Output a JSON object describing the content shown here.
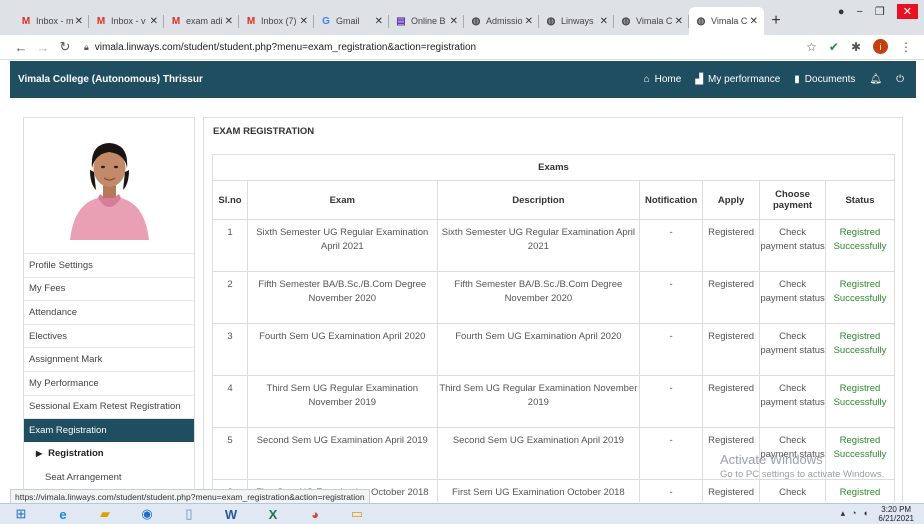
{
  "browser": {
    "tabs": [
      {
        "label": "Inbox - m",
        "icon": "gmail-icon",
        "glyph": "M",
        "color": "#d93025"
      },
      {
        "label": "Inbox - v",
        "icon": "gmail-icon",
        "glyph": "M",
        "color": "#d93025"
      },
      {
        "label": "exam adi",
        "icon": "gmail-icon",
        "glyph": "M",
        "color": "#d93025"
      },
      {
        "label": "Inbox (7)",
        "icon": "gmail-icon",
        "glyph": "M",
        "color": "#d93025"
      },
      {
        "label": "Gmail",
        "icon": "google-icon",
        "glyph": "G",
        "color": "#4285f4"
      },
      {
        "label": "Online B",
        "icon": "form-icon",
        "glyph": "▤",
        "color": "#673ab7"
      },
      {
        "label": "Admissio",
        "icon": "globe-icon",
        "glyph": "◍",
        "color": "#444"
      },
      {
        "label": "Linways",
        "icon": "globe-icon",
        "glyph": "◍",
        "color": "#444"
      },
      {
        "label": "Vimala C",
        "icon": "globe-icon",
        "glyph": "◍",
        "color": "#444"
      },
      {
        "label": "Vimala C",
        "icon": "globe-icon",
        "glyph": "◍",
        "color": "#444",
        "active": true
      }
    ],
    "url": "vimala.linways.com/student/student.php?menu=exam_registration&action=registration",
    "status_url": "https://vimala.linways.com/student/student.php?menu=exam_registration&action=registration"
  },
  "header": {
    "brand": "Vimala College (Autonomous) Thrissur",
    "nav": {
      "home": "Home",
      "performance": "My performance",
      "documents": "Documents"
    }
  },
  "sidebar": {
    "items": [
      "Profile Settings",
      "My Fees",
      "Attendance",
      "Electives",
      "Assignment Mark",
      "My Performance",
      "Sessional Exam Retest Registration",
      "Exam Registration"
    ],
    "sub_active": "Registration",
    "sub_other": "Seat Arrangement"
  },
  "main": {
    "title": "EXAM REGISTRATION",
    "group_header": "Exams",
    "columns": {
      "slno": "Sl.no",
      "exam": "Exam",
      "description": "Description",
      "notification": "Notification",
      "apply": "Apply",
      "choose_payment": "Choose payment",
      "status": "Status"
    },
    "rows": [
      {
        "slno": "1",
        "exam": "Sixth Semester UG Regular Examination April 2021",
        "description": "Sixth Semester UG Regular Examination April 2021",
        "notification": "-",
        "apply": "Registered",
        "payment": "Check payment status",
        "status": "Registred Successfully"
      },
      {
        "slno": "2",
        "exam": "Fifth Semester BA/B.Sc./B.Com Degree November 2020",
        "description": "Fifth Semester BA/B.Sc./B.Com Degree November 2020",
        "notification": "-",
        "apply": "Registered",
        "payment": "Check payment status",
        "status": "Registred Successfully"
      },
      {
        "slno": "3",
        "exam": "Fourth Sem UG Examination April 2020",
        "description": "Fourth Sem UG Examination April 2020",
        "notification": "-",
        "apply": "Registered",
        "payment": "Check payment status",
        "status": "Registred Successfully"
      },
      {
        "slno": "4",
        "exam": "Third Sem UG Regular Examination November 2019",
        "description": "Third Sem UG Regular Examination November 2019",
        "notification": "-",
        "apply": "Registered",
        "payment": "Check payment status",
        "status": "Registred Successfully"
      },
      {
        "slno": "5",
        "exam": "Second Sem UG Examination April 2019",
        "description": "Second Sem UG Examination April 2019",
        "notification": "-",
        "apply": "Registered",
        "payment": "Check payment status",
        "status": "Registred Successfully"
      },
      {
        "slno": "6",
        "exam": "First Sem UG Examination October 2018",
        "description": "First Sem UG Examination October 2018",
        "notification": "-",
        "apply": "Registered",
        "payment": "Check payment status",
        "status": "Registred Successfully"
      }
    ]
  },
  "watermark": {
    "line1": "Activate Windows",
    "line2": "Go to PC settings to activate Windows."
  },
  "taskbar": {
    "time": "3:20 PM",
    "date": "6/21/2021"
  },
  "colors": {
    "header_bg": "#1f4e61",
    "status_green": "#2b8a2b"
  }
}
